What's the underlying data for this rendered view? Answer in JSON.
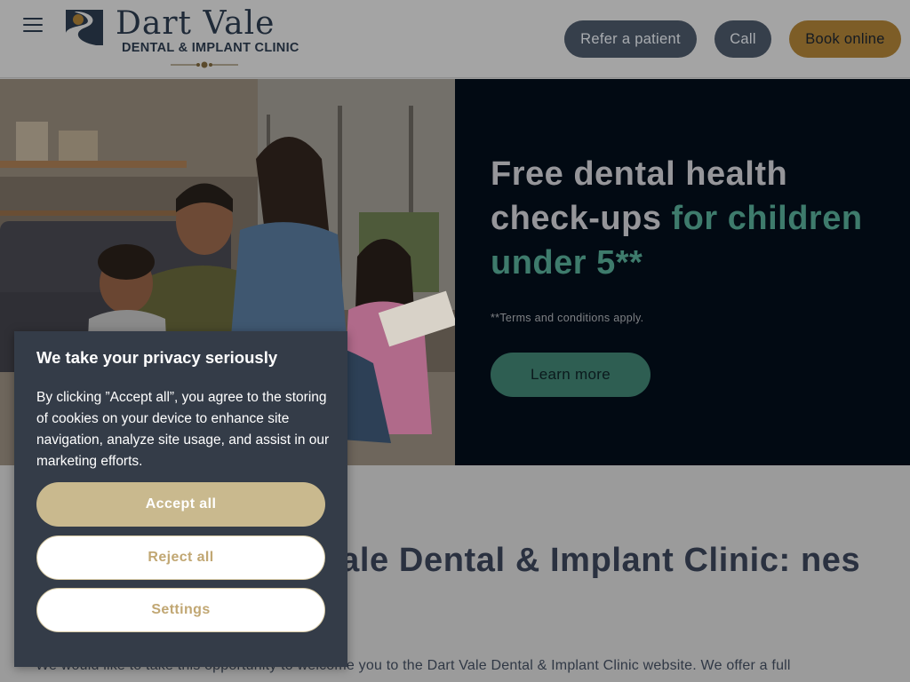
{
  "header": {
    "menu_icon": "hamburger-icon",
    "logo": {
      "title": "Dart Vale",
      "subtitle": "DENTAL & IMPLANT CLINIC",
      "mark_icon": "dart-vale-logo-icon"
    },
    "buttons": {
      "refer": "Refer a patient",
      "call": "Call",
      "book": "Book online"
    }
  },
  "hero": {
    "image_icon": "family-photo",
    "title_plain": "Free dental health check-ups ",
    "title_accent": "for children under 5**",
    "terms": "**Terms and conditions apply.",
    "cta": "Learn more"
  },
  "welcome": {
    "heading": "Welcome to Dart Vale Dental & Implant Clinic: nes",
    "paragraph": "We would like to take this opportunity to welcome you to the Dart Vale Dental & Implant Clinic website. We offer a full"
  },
  "cookie": {
    "title": "We take your privacy seriously",
    "text": "By clicking ”Accept all”, you agree to the storing of cookies on your device to enhance site navigation, analyze site usage, and assist in our marketing efforts.",
    "accept": "Accept all",
    "reject": "Reject all",
    "settings": "Settings"
  },
  "colors": {
    "brand_dark": "#1f2a38",
    "gold": "#c9b98e",
    "teal": "#3e7b6c",
    "panel": "#020a13"
  }
}
